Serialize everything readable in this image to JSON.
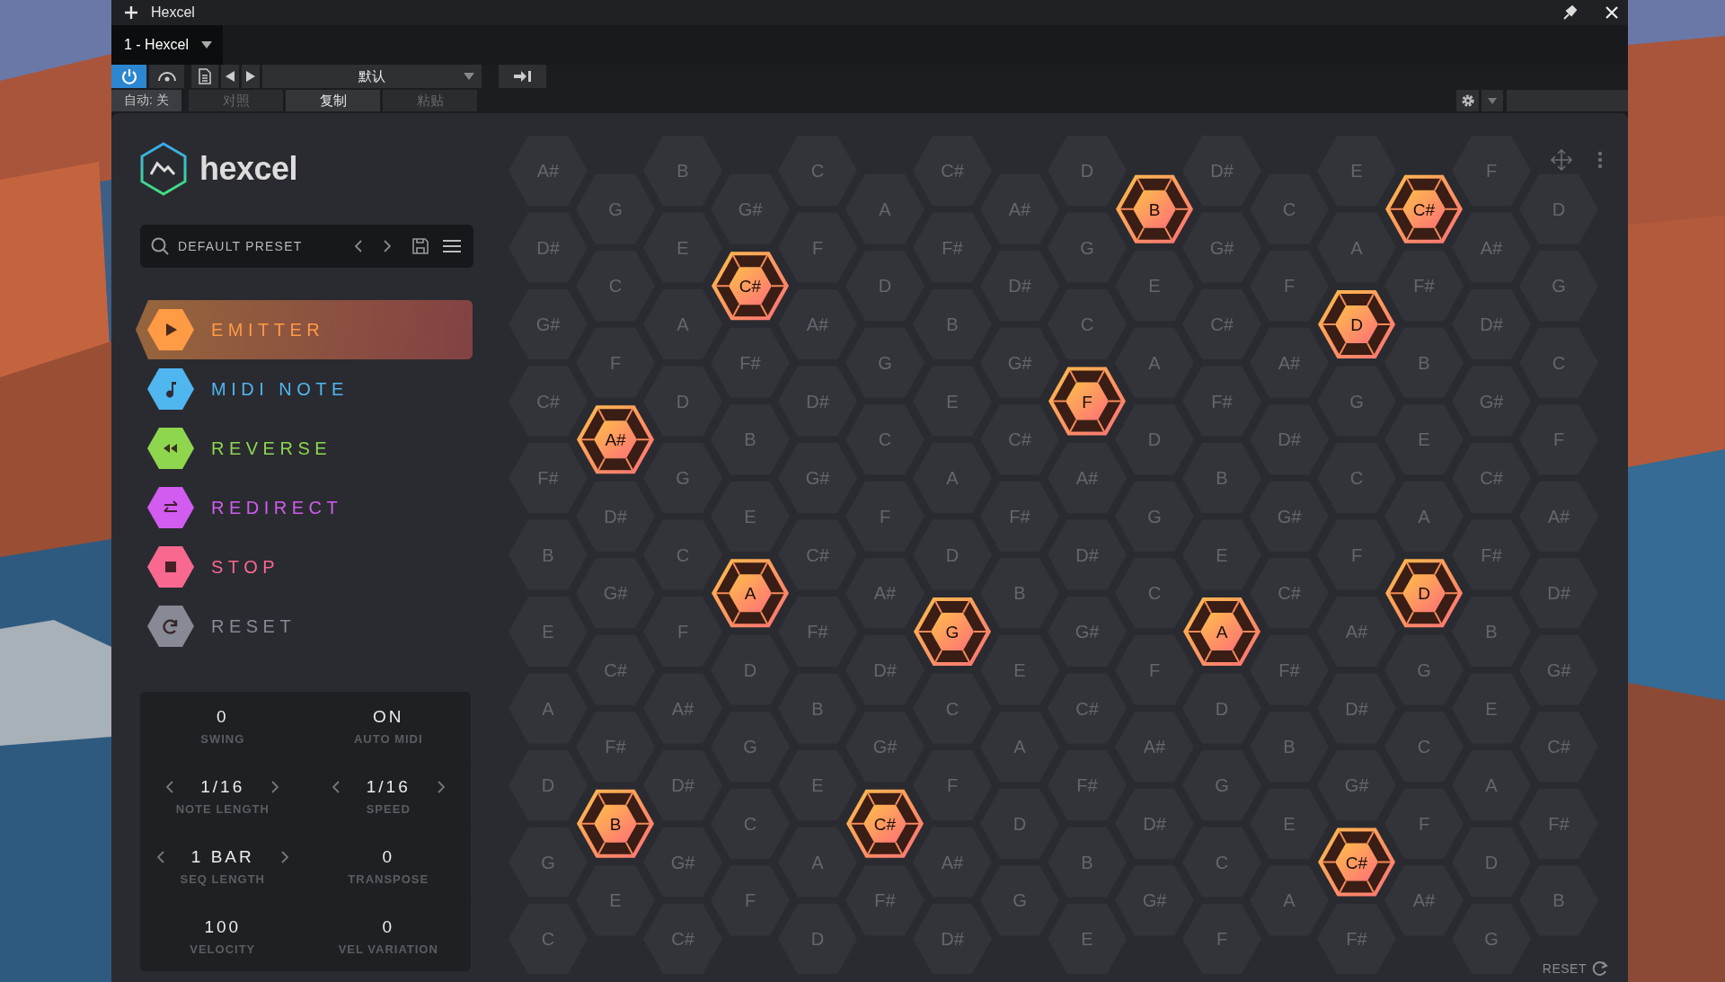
{
  "window": {
    "title": "Hexcel"
  },
  "tab": {
    "label": "1 - Hexcel"
  },
  "toolbar": {
    "power_on": true,
    "preset": "默认",
    "auto": "自动: 关",
    "buttons": [
      {
        "label": "对照",
        "disabled": true
      },
      {
        "label": "复制",
        "disabled": false
      },
      {
        "label": "粘贴",
        "disabled": true
      }
    ]
  },
  "plugin": {
    "logo": "hexcel",
    "preset": "DEFAULT PRESET",
    "tools": [
      {
        "label": "EMITTER",
        "kind": "play",
        "color": "#ff9a45",
        "selected": true
      },
      {
        "label": "MIDI NOTE",
        "kind": "note",
        "color": "#4fb6f0",
        "selected": false
      },
      {
        "label": "REVERSE",
        "kind": "rewind",
        "color": "#8fd64f",
        "selected": false
      },
      {
        "label": "REDIRECT",
        "kind": "swap",
        "color": "#d25cf0",
        "selected": false
      },
      {
        "label": "STOP",
        "kind": "stop",
        "color": "#f9688f",
        "selected": false
      },
      {
        "label": "RESET",
        "kind": "reset",
        "color": "#878a94",
        "selected": false
      }
    ],
    "params": [
      {
        "value": "0",
        "label": "SWING",
        "stepper": false
      },
      {
        "value": "ON",
        "label": "AUTO MIDI",
        "stepper": false
      },
      {
        "value": "1/16",
        "label": "NOTE LENGTH",
        "stepper": true
      },
      {
        "value": "1/16",
        "label": "SPEED",
        "stepper": true
      },
      {
        "value": "1 BAR",
        "label": "SEQ LENGTH",
        "stepper": true
      },
      {
        "value": "0",
        "label": "TRANSPOSE",
        "stepper": false
      },
      {
        "value": "100",
        "label": "VELOCITY",
        "stepper": false
      },
      {
        "value": "0",
        "label": "VEL VARIATION",
        "stepper": false
      }
    ],
    "grid": {
      "columns": [
        {
          "cells": [
            {
              "note": "A#",
              "active": false
            },
            {
              "note": "D#",
              "active": false
            },
            {
              "note": "G#",
              "active": false
            },
            {
              "note": "C#",
              "active": false
            },
            {
              "note": "F#",
              "active": false
            },
            {
              "note": "B",
              "active": false
            },
            {
              "note": "E",
              "active": false
            },
            {
              "note": "A",
              "active": false
            },
            {
              "note": "D",
              "active": false
            },
            {
              "note": "G",
              "active": false
            },
            {
              "note": "C",
              "active": false
            }
          ]
        },
        {
          "cells": [
            {
              "note": "G",
              "active": false
            },
            {
              "note": "C",
              "active": false
            },
            {
              "note": "F",
              "active": false
            },
            {
              "note": "A#",
              "active": true
            },
            {
              "note": "D#",
              "active": false
            },
            {
              "note": "G#",
              "active": false
            },
            {
              "note": "C#",
              "active": false
            },
            {
              "note": "F#",
              "active": false
            },
            {
              "note": "B",
              "active": true
            },
            {
              "note": "E",
              "active": false
            }
          ]
        },
        {
          "cells": [
            {
              "note": "B",
              "active": false
            },
            {
              "note": "E",
              "active": false
            },
            {
              "note": "A",
              "active": false
            },
            {
              "note": "D",
              "active": false
            },
            {
              "note": "G",
              "active": false
            },
            {
              "note": "C",
              "active": false
            },
            {
              "note": "F",
              "active": false
            },
            {
              "note": "A#",
              "active": false
            },
            {
              "note": "D#",
              "active": false
            },
            {
              "note": "G#",
              "active": false
            },
            {
              "note": "C#",
              "active": false
            }
          ]
        },
        {
          "cells": [
            {
              "note": "G#",
              "active": false
            },
            {
              "note": "C#",
              "active": true
            },
            {
              "note": "F#",
              "active": false
            },
            {
              "note": "B",
              "active": false
            },
            {
              "note": "E",
              "active": false
            },
            {
              "note": "A",
              "active": true
            },
            {
              "note": "D",
              "active": false
            },
            {
              "note": "G",
              "active": false
            },
            {
              "note": "C",
              "active": false
            },
            {
              "note": "F",
              "active": false
            }
          ]
        },
        {
          "cells": [
            {
              "note": "C",
              "active": false
            },
            {
              "note": "F",
              "active": false
            },
            {
              "note": "A#",
              "active": false
            },
            {
              "note": "D#",
              "active": false
            },
            {
              "note": "G#",
              "active": false
            },
            {
              "note": "C#",
              "active": false
            },
            {
              "note": "F#",
              "active": false
            },
            {
              "note": "B",
              "active": false
            },
            {
              "note": "E",
              "active": false
            },
            {
              "note": "A",
              "active": false
            },
            {
              "note": "D",
              "active": false
            }
          ]
        },
        {
          "cells": [
            {
              "note": "A",
              "active": false
            },
            {
              "note": "D",
              "active": false
            },
            {
              "note": "G",
              "active": false
            },
            {
              "note": "C",
              "active": false
            },
            {
              "note": "F",
              "active": false
            },
            {
              "note": "A#",
              "active": false
            },
            {
              "note": "D#",
              "active": false
            },
            {
              "note": "G#",
              "active": false
            },
            {
              "note": "C#",
              "active": true
            },
            {
              "note": "F#",
              "active": false
            }
          ]
        },
        {
          "cells": [
            {
              "note": "C#",
              "active": false
            },
            {
              "note": "F#",
              "active": false
            },
            {
              "note": "B",
              "active": false
            },
            {
              "note": "E",
              "active": false
            },
            {
              "note": "A",
              "active": false
            },
            {
              "note": "D",
              "active": false
            },
            {
              "note": "G",
              "active": true
            },
            {
              "note": "C",
              "active": false
            },
            {
              "note": "F",
              "active": false
            },
            {
              "note": "A#",
              "active": false
            },
            {
              "note": "D#",
              "active": false
            }
          ]
        },
        {
          "cells": [
            {
              "note": "A#",
              "active": false
            },
            {
              "note": "D#",
              "active": false
            },
            {
              "note": "G#",
              "active": false
            },
            {
              "note": "C#",
              "active": false
            },
            {
              "note": "F#",
              "active": false
            },
            {
              "note": "B",
              "active": false
            },
            {
              "note": "E",
              "active": false
            },
            {
              "note": "A",
              "active": false
            },
            {
              "note": "D",
              "active": false
            },
            {
              "note": "G",
              "active": false
            }
          ]
        },
        {
          "cells": [
            {
              "note": "D",
              "active": false
            },
            {
              "note": "G",
              "active": false
            },
            {
              "note": "C",
              "active": false
            },
            {
              "note": "F",
              "active": true
            },
            {
              "note": "A#",
              "active": false
            },
            {
              "note": "D#",
              "active": false
            },
            {
              "note": "G#",
              "active": false
            },
            {
              "note": "C#",
              "active": false
            },
            {
              "note": "F#",
              "active": false
            },
            {
              "note": "B",
              "active": false
            },
            {
              "note": "E",
              "active": false
            }
          ]
        },
        {
          "cells": [
            {
              "note": "B",
              "active": true
            },
            {
              "note": "E",
              "active": false
            },
            {
              "note": "A",
              "active": false
            },
            {
              "note": "D",
              "active": false
            },
            {
              "note": "G",
              "active": false
            },
            {
              "note": "C",
              "active": false
            },
            {
              "note": "F",
              "active": false
            },
            {
              "note": "A#",
              "active": false
            },
            {
              "note": "D#",
              "active": false
            },
            {
              "note": "G#",
              "active": false
            }
          ]
        },
        {
          "cells": [
            {
              "note": "D#",
              "active": false
            },
            {
              "note": "G#",
              "active": false
            },
            {
              "note": "C#",
              "active": false
            },
            {
              "note": "F#",
              "active": false
            },
            {
              "note": "B",
              "active": false
            },
            {
              "note": "E",
              "active": false
            },
            {
              "note": "A",
              "active": true
            },
            {
              "note": "D",
              "active": false
            },
            {
              "note": "G",
              "active": false
            },
            {
              "note": "C",
              "active": false
            },
            {
              "note": "F",
              "active": false
            }
          ]
        },
        {
          "cells": [
            {
              "note": "C",
              "active": false
            },
            {
              "note": "F",
              "active": false
            },
            {
              "note": "A#",
              "active": false
            },
            {
              "note": "D#",
              "active": false
            },
            {
              "note": "G#",
              "active": false
            },
            {
              "note": "C#",
              "active": false
            },
            {
              "note": "F#",
              "active": false
            },
            {
              "note": "B",
              "active": false
            },
            {
              "note": "E",
              "active": false
            },
            {
              "note": "A",
              "active": false
            }
          ]
        },
        {
          "cells": [
            {
              "note": "E",
              "active": false
            },
            {
              "note": "A",
              "active": false
            },
            {
              "note": "D",
              "active": true
            },
            {
              "note": "G",
              "active": false
            },
            {
              "note": "C",
              "active": false
            },
            {
              "note": "F",
              "active": false
            },
            {
              "note": "A#",
              "active": false
            },
            {
              "note": "D#",
              "active": false
            },
            {
              "note": "G#",
              "active": false
            },
            {
              "note": "C#",
              "active": true
            },
            {
              "note": "F#",
              "active": false
            }
          ]
        },
        {
          "cells": [
            {
              "note": "C#",
              "active": true
            },
            {
              "note": "F#",
              "active": false
            },
            {
              "note": "B",
              "active": false
            },
            {
              "note": "E",
              "active": false
            },
            {
              "note": "A",
              "active": false
            },
            {
              "note": "D",
              "active": true
            },
            {
              "note": "G",
              "active": false
            },
            {
              "note": "C",
              "active": false
            },
            {
              "note": "F",
              "active": false
            },
            {
              "note": "A#",
              "active": false
            }
          ]
        },
        {
          "cells": [
            {
              "note": "F",
              "active": false
            },
            {
              "note": "A#",
              "active": false
            },
            {
              "note": "D#",
              "active": false
            },
            {
              "note": "G#",
              "active": false
            },
            {
              "note": "C#",
              "active": false
            },
            {
              "note": "F#",
              "active": false
            },
            {
              "note": "B",
              "active": false
            },
            {
              "note": "E",
              "active": false
            },
            {
              "note": "A",
              "active": false
            },
            {
              "note": "D",
              "active": false
            },
            {
              "note": "G",
              "active": false
            }
          ]
        },
        {
          "cells": [
            {
              "note": "D",
              "active": false
            },
            {
              "note": "G",
              "active": false
            },
            {
              "note": "C",
              "active": false
            },
            {
              "note": "F",
              "active": false
            },
            {
              "note": "A#",
              "active": false
            },
            {
              "note": "D#",
              "active": false
            },
            {
              "note": "G#",
              "active": false
            },
            {
              "note": "C#",
              "active": false
            },
            {
              "note": "F#",
              "active": false
            },
            {
              "note": "B",
              "active": false
            }
          ]
        }
      ]
    },
    "reset": "RESET"
  }
}
